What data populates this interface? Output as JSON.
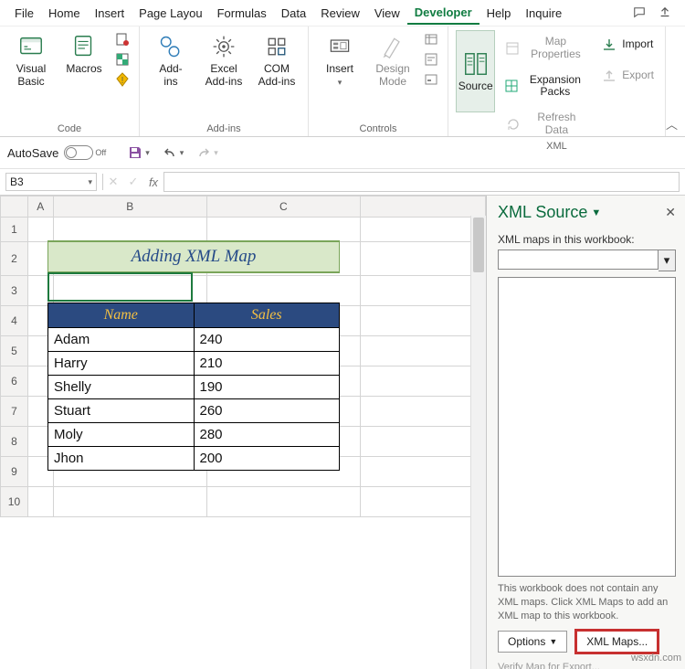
{
  "menu": {
    "tabs": [
      "File",
      "Home",
      "Insert",
      "Page Layou",
      "Formulas",
      "Data",
      "Review",
      "View",
      "Developer",
      "Help",
      "Inquire"
    ],
    "active_index": 8
  },
  "ribbon": {
    "groups": {
      "code": {
        "label": "Code",
        "visual_basic": "Visual\nBasic",
        "macros": "Macros"
      },
      "addins": {
        "label": "Add-ins",
        "addins": "Add-\nins",
        "excel": "Excel\nAdd-ins",
        "com": "COM\nAdd-ins"
      },
      "controls": {
        "label": "Controls",
        "insert": "Insert",
        "design": "Design\nMode"
      },
      "xml": {
        "label": "XML",
        "source": "Source",
        "map_props": "Map Properties",
        "expansion": "Expansion Packs",
        "refresh": "Refresh Data",
        "import": "Import",
        "export": "Export"
      }
    }
  },
  "qat": {
    "autosave": "AutoSave",
    "off": "Off"
  },
  "namebox": {
    "ref": "B3"
  },
  "columns": [
    "A",
    "B",
    "C"
  ],
  "rows": [
    "1",
    "2",
    "3",
    "4",
    "5",
    "6",
    "7",
    "8",
    "9",
    "10"
  ],
  "banner": "Adding XML Map",
  "table": {
    "headers": [
      "Name",
      "Sales"
    ],
    "rows": [
      [
        "Adam",
        "240"
      ],
      [
        "Harry",
        "210"
      ],
      [
        "Shelly",
        "190"
      ],
      [
        "Stuart",
        "260"
      ],
      [
        "Moly",
        "280"
      ],
      [
        "Jhon",
        "200"
      ]
    ]
  },
  "taskpane": {
    "title": "XML Source",
    "maps_label": "XML maps in this workbook:",
    "help": "This workbook does not contain any XML maps. Click XML Maps to add an XML map to this workbook.",
    "options": "Options",
    "xml_maps": "XML Maps...",
    "verify": "Verify Map for Export..."
  },
  "watermark": "wsxdn.com"
}
